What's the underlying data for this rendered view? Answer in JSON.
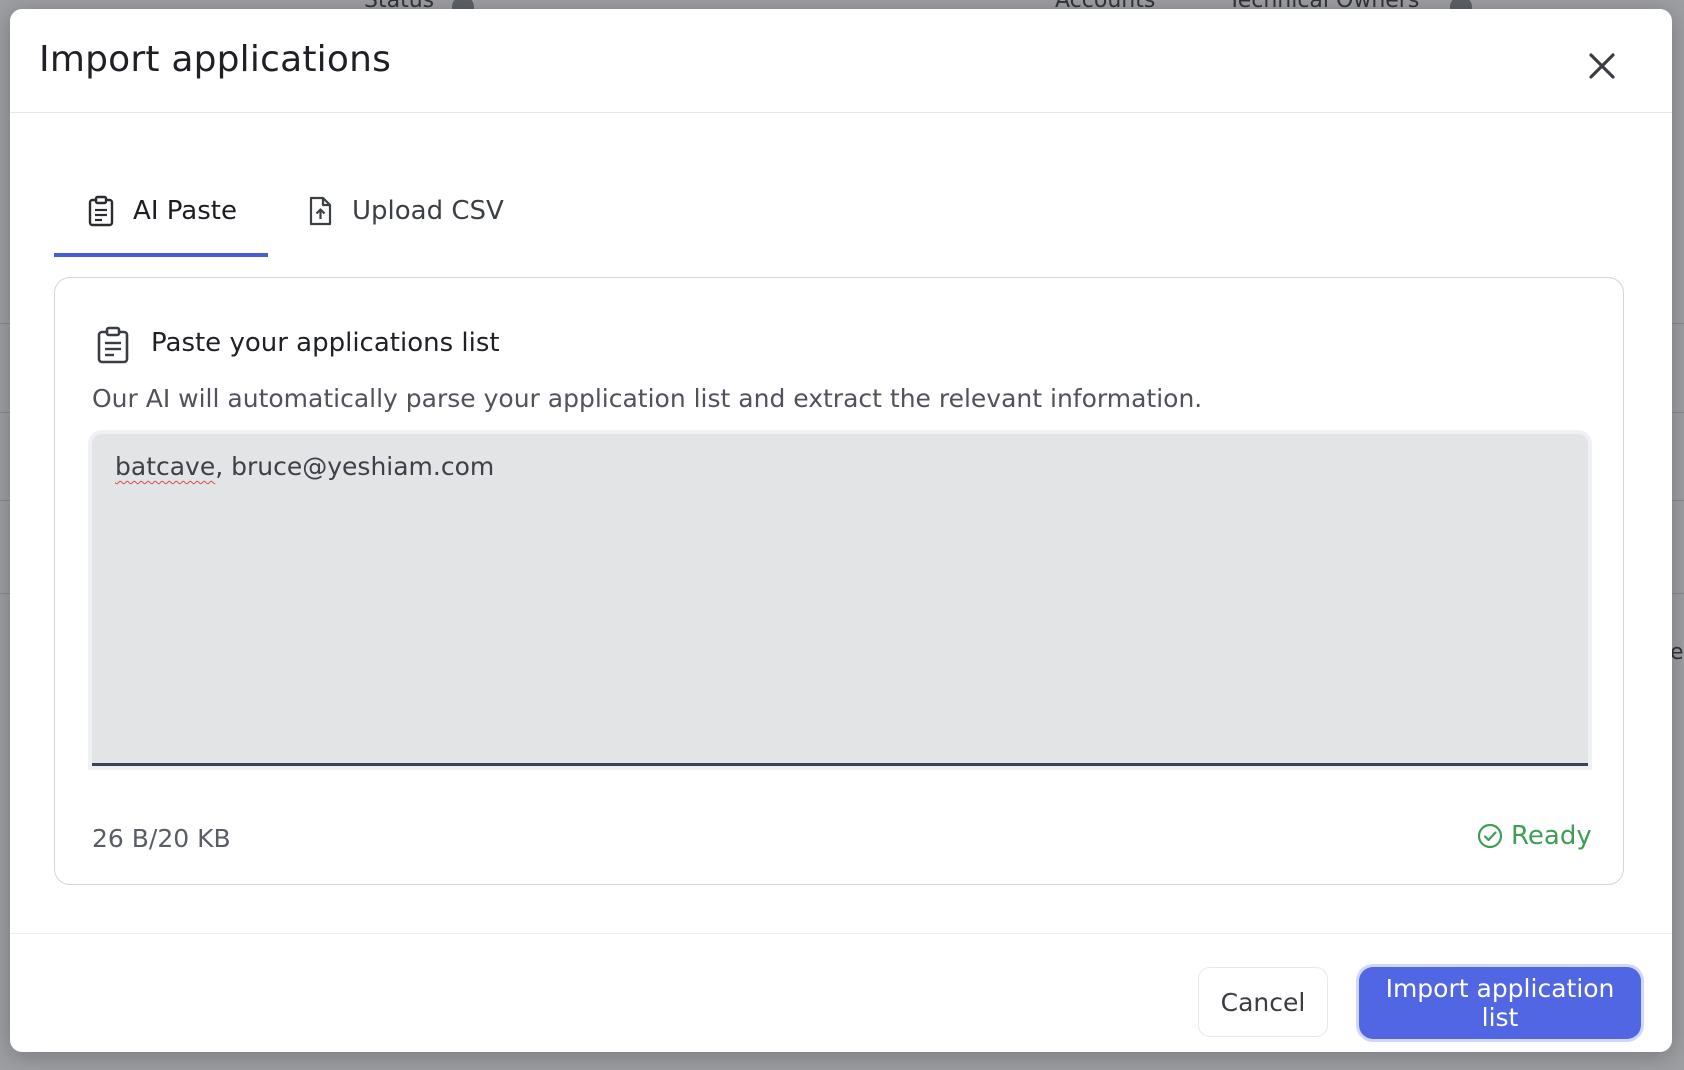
{
  "background": {
    "header_columns": [
      "Status",
      "Accounts",
      "Technical Owners"
    ],
    "edge_fragment": "e"
  },
  "modal": {
    "title": "Import applications",
    "close_icon": "close-icon"
  },
  "tabs": [
    {
      "label": "AI Paste",
      "icon": "clipboard-icon",
      "active": true
    },
    {
      "label": "Upload CSV",
      "icon": "file-upload-icon",
      "active": false
    }
  ],
  "card": {
    "title": "Paste your applications list",
    "description": "Our AI will automatically parse your application list and extract the relevant information.",
    "input_value": "batcave, bruce@yeshiam.com",
    "input_value_misspelled": "batcave",
    "input_value_rest": ", bruce@yeshiam.com",
    "size_text": "26 B/20 KB",
    "status": "Ready"
  },
  "footer": {
    "cancel_label": "Cancel",
    "import_label": "Import application list"
  },
  "colors": {
    "accent": "#5166e3",
    "tab_underline": "#4a5dd6",
    "ready_green": "#3f9e54",
    "input_bg": "#e3e4e6"
  }
}
